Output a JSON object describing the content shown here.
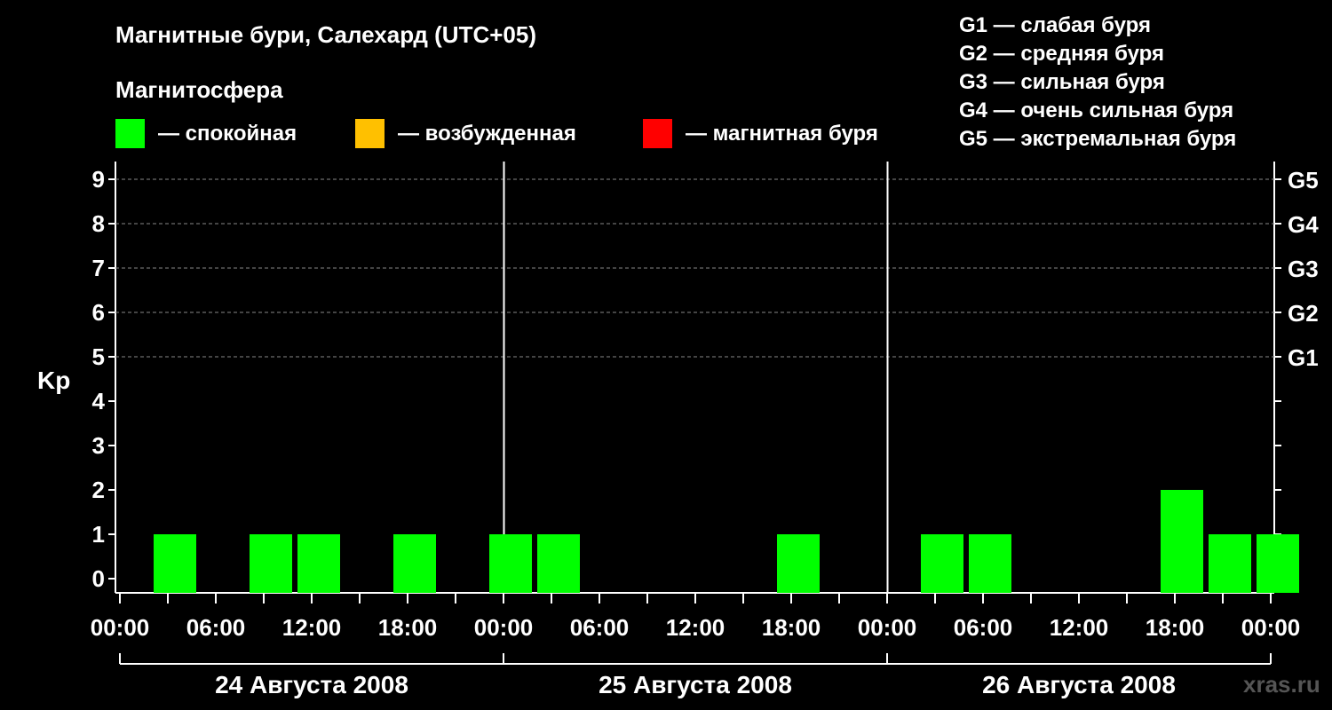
{
  "title": "Магнитные бури, Салехард (UTC+05)",
  "legend": {
    "heading": "Магнитосфера",
    "items": [
      {
        "label": "— спокойная",
        "color": "#00ff00"
      },
      {
        "label": "— возбужденная",
        "color": "#ffc000"
      },
      {
        "label": "— магнитная буря",
        "color": "#ff0000"
      }
    ]
  },
  "storm_levels": [
    "G1 — слабая буря",
    "G2 — средняя буря",
    "G3 — сильная буря",
    "G4 — очень сильная буря",
    "G5 — экстремальная буря"
  ],
  "watermark": "xras.ru",
  "chart_data": {
    "type": "bar",
    "ylabel": "Kp",
    "ylim": [
      0,
      9
    ],
    "yticks": [
      "0",
      "1",
      "2",
      "3",
      "4",
      "5",
      "6",
      "7",
      "8",
      "9"
    ],
    "right_axis_labels": [
      {
        "kp": 5,
        "label": "G1"
      },
      {
        "kp": 6,
        "label": "G2"
      },
      {
        "kp": 7,
        "label": "G3"
      },
      {
        "kp": 8,
        "label": "G4"
      },
      {
        "kp": 9,
        "label": "G5"
      }
    ],
    "xticks": [
      "00:00",
      "06:00",
      "12:00",
      "18:00",
      "00:00",
      "06:00",
      "12:00",
      "18:00",
      "00:00",
      "06:00",
      "12:00",
      "18:00",
      "00:00"
    ],
    "days": [
      "24 Августа 2008",
      "25 Августа 2008",
      "26 Августа 2008"
    ],
    "grid": true,
    "interval_hours": 3,
    "colors": {
      "quiet": "#00ff00"
    },
    "bars": [
      {
        "day": 0,
        "start_hour": 2,
        "kp": 1
      },
      {
        "day": 0,
        "start_hour": 8,
        "kp": 1
      },
      {
        "day": 0,
        "start_hour": 11,
        "kp": 1
      },
      {
        "day": 0,
        "start_hour": 17,
        "kp": 1
      },
      {
        "day": 0,
        "start_hour": 23,
        "kp": 1
      },
      {
        "day": 1,
        "start_hour": 2,
        "kp": 1
      },
      {
        "day": 1,
        "start_hour": 17,
        "kp": 1
      },
      {
        "day": 2,
        "start_hour": 2,
        "kp": 1
      },
      {
        "day": 2,
        "start_hour": 5,
        "kp": 1
      },
      {
        "day": 2,
        "start_hour": 17,
        "kp": 2
      },
      {
        "day": 2,
        "start_hour": 20,
        "kp": 1
      },
      {
        "day": 2,
        "start_hour": 23,
        "kp": 1
      }
    ]
  }
}
